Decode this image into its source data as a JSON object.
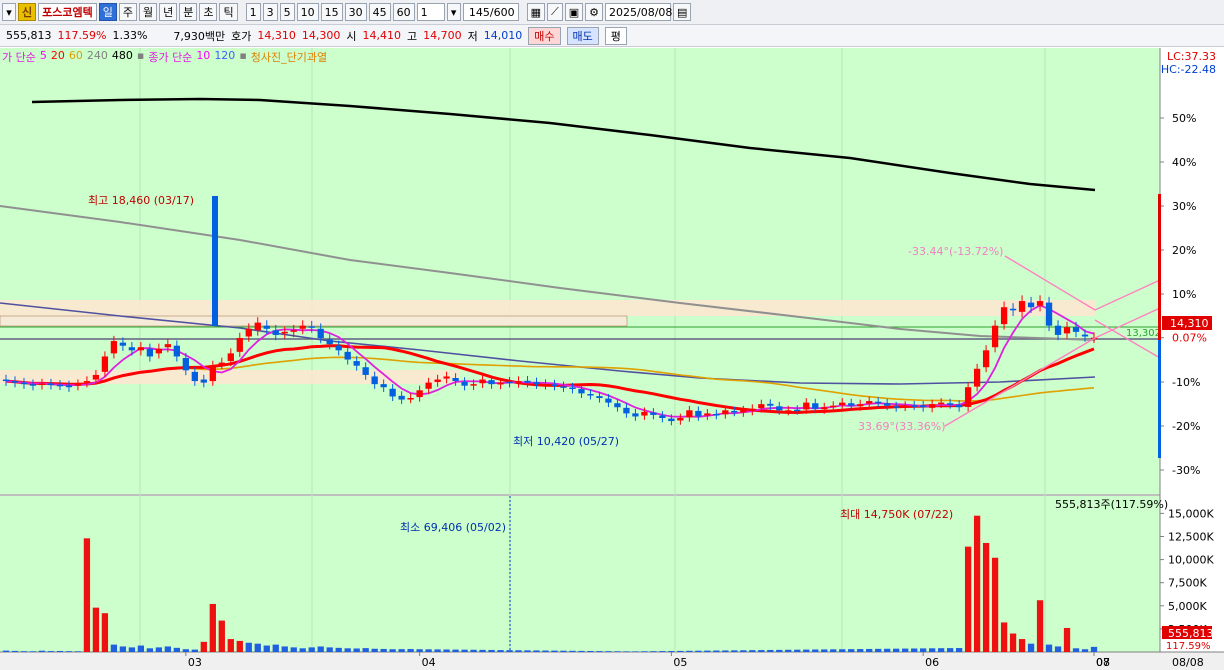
{
  "toolbar": {
    "new_badge": "신",
    "stock_name": "포스코엠텍",
    "periods": [
      "일",
      "주",
      "월",
      "년",
      "분",
      "초",
      "틱"
    ],
    "active_period": "일",
    "intervals": [
      "1",
      "3",
      "5",
      "10",
      "15",
      "30",
      "45",
      "60"
    ],
    "unit": "1",
    "count": "145/600",
    "date": "2025/08/08"
  },
  "quote": {
    "volume": "555,813",
    "volume_ratio": "117.59%",
    "change_rate": "1.33%",
    "amount": "7,930백만",
    "bid_label": "호가",
    "bid1": "14,310",
    "bid2": "14,300",
    "open_label": "시",
    "open": "14,410",
    "high_label": "고",
    "high": "14,700",
    "low_label": "저",
    "low": "14,010",
    "buy_label": "매수",
    "sell_label": "매도",
    "flat_label": "평"
  },
  "legend": {
    "prefix": "가 단순",
    "ma": [
      "5",
      "20",
      "60",
      "240",
      "480"
    ],
    "vol_prefix": "종가 단순",
    "vol_ma": [
      "10",
      "120"
    ],
    "signal": "청사진_단기과열"
  },
  "side": {
    "lc": "LC:37.33",
    "hc": "HC:-22.48"
  },
  "chart_data": {
    "type": "candlestick",
    "y_axis_percent": [
      "50%",
      "40%",
      "30%",
      "20%",
      "10%",
      "0.07%",
      "-10%",
      "-20%",
      "-30%"
    ],
    "volume_axis": [
      "15,000K",
      "12,500K",
      "10,000K",
      "7,500K",
      "5,000K",
      "2,500K"
    ],
    "x_months": [
      "03",
      "04",
      "05",
      "06",
      "07",
      "08"
    ],
    "x_right_label": "08/08",
    "current_price": "14,310",
    "current_volume": "555,813",
    "current_volume_ratio": "117.59%",
    "volume_note": "555,813주(117.59%)",
    "annotations": {
      "high": "최고 18,460 (03/17)",
      "low": "최저 10,420 (05/27)",
      "vol_min": "최소 69,406 (05/02)",
      "vol_max": "최대 14,750K (07/22)",
      "angle_top": "-33.44°(-13.72%)",
      "angle_bottom": "33.69°(33.36%)",
      "target": "13,302"
    },
    "closes": [
      12900,
      12850,
      12800,
      12750,
      12820,
      12780,
      12760,
      12700,
      12800,
      12900,
      13100,
      13700,
      14200,
      14050,
      13900,
      14000,
      13700,
      13950,
      14100,
      13700,
      13250,
      12900,
      12850,
      13400,
      13500,
      13800,
      14300,
      14600,
      14800,
      14600,
      14400,
      14500,
      14550,
      14700,
      14650,
      14300,
      14100,
      13900,
      13600,
      13400,
      13100,
      12800,
      12700,
      12400,
      12300,
      12350,
      12600,
      12850,
      12950,
      13050,
      12900,
      12750,
      12800,
      12950,
      12800,
      12850,
      12850,
      12900,
      12850,
      12800,
      12800,
      12750,
      12700,
      12650,
      12500,
      12450,
      12350,
      12200,
      12050,
      11850,
      11750,
      11900,
      11800,
      11700,
      11600,
      11700,
      11950,
      11750,
      11850,
      11800,
      11950,
      11900,
      11950,
      12000,
      12150,
      12100,
      11950,
      11950,
      11950,
      12200,
      12000,
      12050,
      12100,
      12200,
      12100,
      12150,
      12250,
      12200,
      12100,
      12050,
      12100,
      12100,
      12050,
      12150,
      12200,
      12150,
      12050,
      12700,
      13300,
      13900,
      14700,
      15300,
      15200,
      15500,
      15300,
      15500,
      14700,
      14400,
      14650,
      14500,
      14350,
      14310
    ],
    "opens": [
      12950,
      12900,
      12850,
      12800,
      12780,
      12820,
      12780,
      12760,
      12750,
      12850,
      12950,
      13200,
      13800,
      14150,
      14000,
      13900,
      13950,
      13800,
      14000,
      14050,
      13650,
      13200,
      12950,
      12900,
      13450,
      13550,
      13850,
      14350,
      14550,
      14700,
      14550,
      14450,
      14500,
      14600,
      14680,
      14600,
      14250,
      14050,
      13850,
      13550,
      13350,
      13050,
      12800,
      12650,
      12420,
      12330,
      12380,
      12650,
      12870,
      12980,
      13000,
      12870,
      12760,
      12830,
      12930,
      12790,
      12880,
      12840,
      12910,
      12860,
      12780,
      12790,
      12730,
      12690,
      12640,
      12480,
      12410,
      12330,
      12180,
      12030,
      11850,
      11780,
      11880,
      11780,
      11680,
      11620,
      11720,
      11930,
      11780,
      11830,
      11820,
      11930,
      11880,
      11930,
      12020,
      12160,
      12080,
      11930,
      11970,
      11980,
      12180,
      11980,
      12070,
      12120,
      12180,
      12080,
      12170,
      12230,
      12180,
      12080,
      12070,
      12110,
      12110,
      12030,
      12170,
      12180,
      12130,
      12060,
      12720,
      13350,
      14000,
      14750,
      15250,
      15150,
      15450,
      15350,
      15450,
      14700,
      14450,
      14650,
      14410
    ],
    "volumes": [
      150,
      120,
      90,
      80,
      140,
      100,
      110,
      90,
      80,
      12300,
      4800,
      4200,
      800,
      600,
      500,
      700,
      400,
      500,
      600,
      450,
      300,
      260,
      1100,
      5200,
      3400,
      1400,
      1200,
      1000,
      900,
      700,
      800,
      600,
      500,
      400,
      500,
      600,
      500,
      450,
      400,
      380,
      420,
      350,
      330,
      300,
      310,
      320,
      300,
      290,
      280,
      270,
      260,
      250,
      240,
      230,
      220,
      210,
      200,
      190,
      180,
      170,
      160,
      150,
      140,
      130,
      120,
      110,
      100,
      90,
      80,
      70,
      69,
      80,
      90,
      100,
      110,
      120,
      130,
      140,
      150,
      160,
      170,
      180,
      190,
      200,
      210,
      220,
      230,
      240,
      250,
      260,
      270,
      280,
      290,
      300,
      310,
      320,
      330,
      340,
      350,
      360,
      370,
      380,
      390,
      400,
      410,
      420,
      430,
      11400,
      14750,
      11800,
      10200,
      3200,
      2000,
      1400,
      900,
      5600,
      800,
      600,
      2600,
      400,
      300,
      556
    ]
  }
}
